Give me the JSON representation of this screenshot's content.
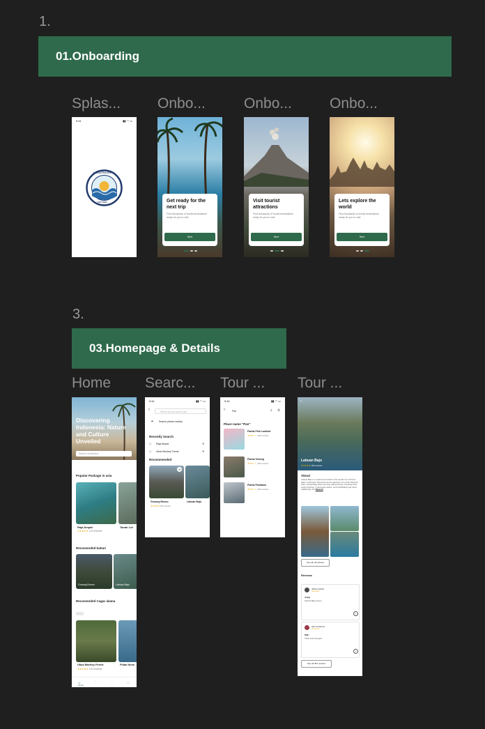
{
  "sections": [
    {
      "number": "1.",
      "banner": "01.Onboarding"
    },
    {
      "number": "3.",
      "banner": "03.Homepage & Details"
    }
  ],
  "onboarding_frames": [
    {
      "label": "Splas..."
    },
    {
      "label": "Onbo...",
      "heading": "Get ready for the next trip",
      "body": "Find thousands of tourist destinations ready for you to visit",
      "button": "Next"
    },
    {
      "label": "Onbo...",
      "heading": "Visit tourist attractions",
      "body": "Find thousands of tourist destinations ready for you to visit",
      "button": "Next"
    },
    {
      "label": "Onbo...",
      "heading": "Lets explore the world",
      "body": "Find thousands of tourist destinations ready for you to visit",
      "button": "Next"
    }
  ],
  "splash": {
    "time": "9:41",
    "logo_text": "LOKATRAVEL",
    "est": "EST 2024"
  },
  "home_frames": [
    {
      "label": "Home"
    },
    {
      "label": "Searc..."
    },
    {
      "label": "Tour ..."
    },
    {
      "label": "Tour ..."
    }
  ],
  "home": {
    "hero_title": "Discovering Indonesia: Nature and Culture Unveiled",
    "search_placeholder": "Search destination",
    "popular_title": "Popular Package in asia",
    "popular_items": [
      {
        "name": "Raja Ampat",
        "reviews": "120 reviews"
      },
      {
        "name": "Tanah Lot",
        "reviews": ""
      }
    ],
    "bahari_title": "Recomended bahari",
    "bahari_items": [
      "Gunung Bromo",
      "Labuan Bajo"
    ],
    "cagar_title": "Recomended Cagar alama",
    "cagar_items": [
      {
        "name": "Ubud Monkey Forest",
        "reviews": "100 reviews"
      },
      {
        "name": "Pulau Nusa",
        "reviews": ""
      }
    ],
    "tabs": [
      "Home",
      "",
      "",
      ""
    ]
  },
  "search": {
    "time": "9:41",
    "placeholder": "Where do you want to go?",
    "nearby": "Search places nearby",
    "recent_title": "Recently Search",
    "recent_items": [
      "Raja Ampat",
      "Ubud Monkey Forest"
    ],
    "recommended_title": "Recommended",
    "recommended_items": [
      {
        "name": "Gunung Bromo",
        "reviews": "88 reviews"
      },
      {
        "name": "Labuan Bajo",
        "reviews": ""
      }
    ]
  },
  "tour_list": {
    "time": "9:41",
    "search_value": "Pan",
    "result_title": "Place name \"Pan\"",
    "items": [
      {
        "name": "Pantai Pink Lombok",
        "reviews": "100 reviews"
      },
      {
        "name": "Pantai Sekeng",
        "reviews": "100 reviews"
      },
      {
        "name": "Pantai Pandawa",
        "reviews": "100 reviews"
      }
    ]
  },
  "tour_detail": {
    "place": "Labuan Bajo",
    "place_reviews": "100 reviews",
    "about_title": "About",
    "about_text": "Labuan Bajo is a small town located in the western tip of Flores Island, Indonesia. Renowned as the gateway to Komodo National Park. Labuan Bajo offers stunning natural beauty, including white sandy beaches, crystal-clear waters, and breathtaking sea views. Additionally, this",
    "read_all": "Read all",
    "see_all_photos": "See all +20 photos",
    "reviews_title": "Reviews",
    "reviews": [
      {
        "name": "Jeffrey Adrian",
        "title": "Anjay",
        "text": "Selesh Bajo keren..."
      },
      {
        "name": "Alex Anderson",
        "title": "Wah",
        "text": "Titiek sudo dengar..."
      }
    ],
    "see_all_reviews": "See all 487 reviews"
  },
  "colors": {
    "accent": "#2e6a4b",
    "background": "#1f1f1f"
  }
}
